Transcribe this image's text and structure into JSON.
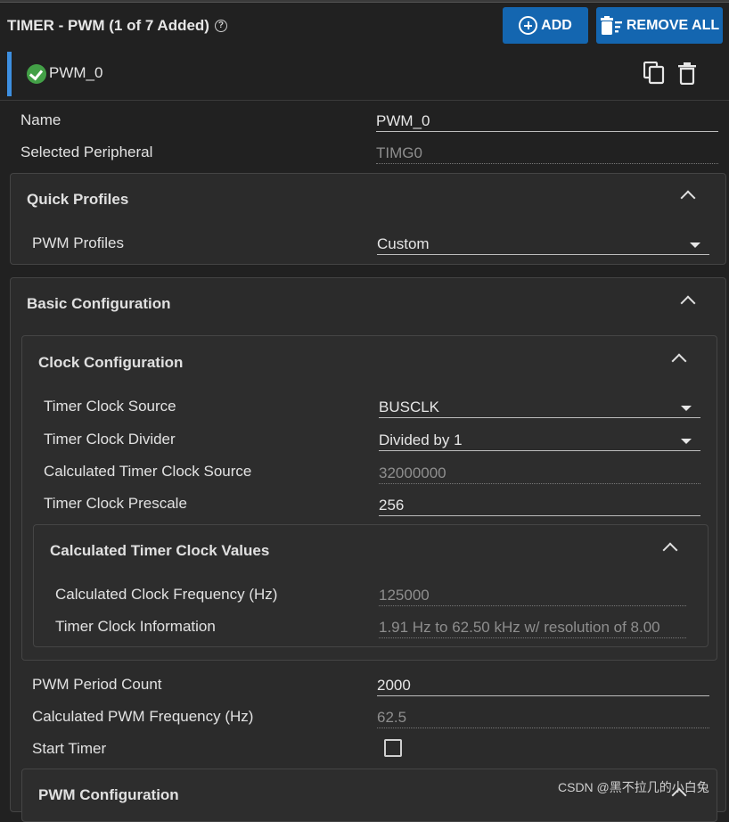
{
  "header": {
    "title": "TIMER - PWM (1 of 7 Added)",
    "add_label": "ADD",
    "remove_all_label": "REMOVE ALL"
  },
  "instance": {
    "name": "PWM_0"
  },
  "fields": {
    "name": {
      "label": "Name",
      "value": "PWM_0"
    },
    "peripheral": {
      "label": "Selected Peripheral",
      "value": "TIMG0"
    }
  },
  "quick_profiles": {
    "title": "Quick Profiles",
    "pwm_profiles": {
      "label": "PWM Profiles",
      "value": "Custom"
    }
  },
  "basic_config": {
    "title": "Basic Configuration",
    "clock_config": {
      "title": "Clock Configuration",
      "clock_source": {
        "label": "Timer Clock Source",
        "value": "BUSCLK"
      },
      "clock_divider": {
        "label": "Timer Clock Divider",
        "value": "Divided by 1"
      },
      "calc_clock_source": {
        "label": "Calculated Timer Clock Source",
        "value": "32000000"
      },
      "prescale": {
        "label": "Timer Clock Prescale",
        "value": "256"
      },
      "calc_values": {
        "title": "Calculated Timer Clock Values",
        "freq": {
          "label": "Calculated Clock Frequency (Hz)",
          "value": "125000"
        },
        "info": {
          "label": "Timer Clock Information",
          "value": "1.91 Hz to 62.50 kHz w/ resolution of 8.00"
        }
      }
    },
    "pwm_period_count": {
      "label": "PWM Period Count",
      "value": "2000"
    },
    "calc_pwm_freq": {
      "label": "Calculated PWM Frequency (Hz)",
      "value": "62.5"
    },
    "start_timer": {
      "label": "Start Timer",
      "checked": false
    }
  },
  "pwm_config": {
    "title": "PWM Configuration"
  },
  "watermark": "CSDN @黑不拉几的小白兔",
  "colors": {
    "accent_blue": "#1466b0",
    "success_green": "#43a047",
    "indicator": "#3d8fe0"
  }
}
